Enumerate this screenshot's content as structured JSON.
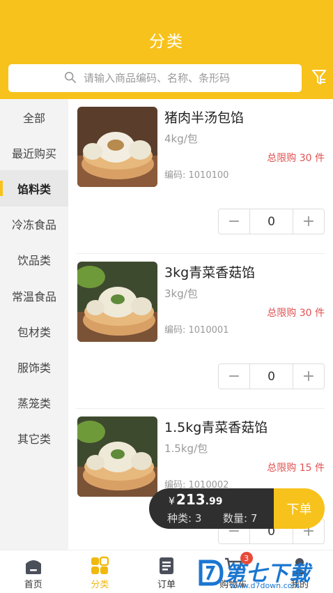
{
  "header": {
    "title": "分类"
  },
  "search": {
    "placeholder": "请输入商品编码、名称、条形码"
  },
  "sidebar": {
    "items": [
      {
        "label": "全部"
      },
      {
        "label": "最近购买"
      },
      {
        "label": "馅料类",
        "active": true
      },
      {
        "label": "冷冻食品"
      },
      {
        "label": "饮品类"
      },
      {
        "label": "常温食品"
      },
      {
        "label": "包材类"
      },
      {
        "label": "服饰类"
      },
      {
        "label": "蒸笼类"
      },
      {
        "label": "其它类"
      }
    ]
  },
  "products": [
    {
      "name": "猪肉半汤包馅",
      "unit": "4kg/包",
      "limit": "总限购 30 件",
      "code": "编码: 1010100",
      "qty": "0",
      "minus": "−",
      "plus": "+"
    },
    {
      "name": "3kg青菜香菇馅",
      "unit": "3kg/包",
      "limit": "总限购 30 件",
      "code": "编码: 1010001",
      "qty": "0",
      "minus": "−",
      "plus": "+"
    },
    {
      "name": "1.5kg青菜香菇馅",
      "unit": "1.5kg/包",
      "limit": "总限购 15 件",
      "code": "编码: 1010002",
      "qty": "0",
      "minus": "−",
      "plus": "+"
    }
  ],
  "cart": {
    "currency": "¥",
    "total_int": "213",
    "total_dec": ".99",
    "kinds": "种类: 3",
    "quantity": "数量: 7",
    "order_label": "下单"
  },
  "tabbar": {
    "items": [
      {
        "label": "首页",
        "icon": "home-icon"
      },
      {
        "label": "分类",
        "icon": "category-icon",
        "active": true
      },
      {
        "label": "订单",
        "icon": "order-icon"
      },
      {
        "label": "购物车",
        "icon": "cart-icon",
        "badge": "3"
      },
      {
        "label": "我的",
        "icon": "profile-icon"
      }
    ]
  },
  "watermark": {
    "text": "第七下载站",
    "url": "www.d7down.com"
  },
  "colors": {
    "accent": "#f7c21b",
    "limit_red": "#e05050",
    "cart_dark": "#2f2f2f"
  }
}
